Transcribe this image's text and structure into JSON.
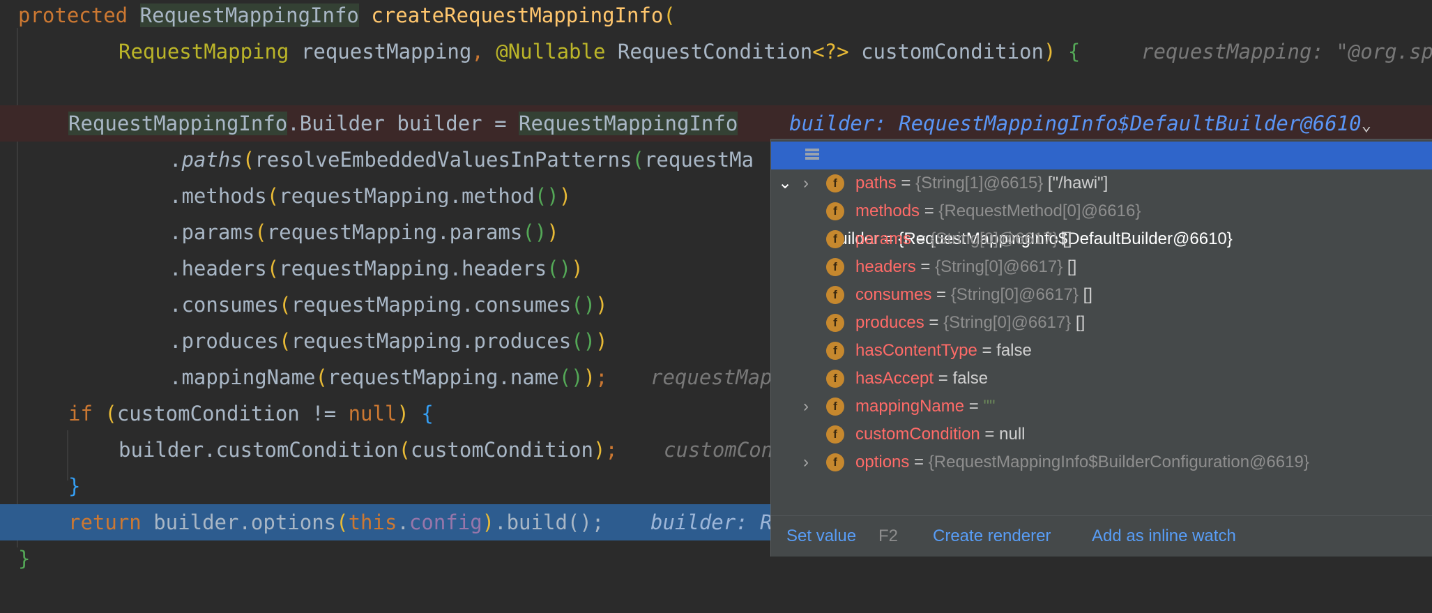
{
  "code": {
    "line1": {
      "kw": "protected",
      "type": "RequestMappingInfo",
      "method": "createRequestMappingInfo",
      "paren": "("
    },
    "line2": {
      "param_type": "RequestMapping",
      "param_name": " requestMapping",
      "comma": ", ",
      "annotation": "@Nullable",
      "type2": " RequestCondition",
      "generic": "<?>",
      "param2": " customCondition",
      "close": ") ",
      "brace": "{",
      "hint": "requestMapping: \"@org.sp"
    },
    "line4": {
      "type": "RequestMappingInfo",
      "rest": ".Builder builder = ",
      "type2": "RequestMappingInfo",
      "hint": "builder: RequestMappingInfo$DefaultBuilder@6610",
      "hint_chevron": "⌄"
    },
    "line5": {
      "dot": ".",
      "method": "paths",
      "open": "(",
      "arg": "resolveEmbeddedValuesInPatterns",
      "open2": "(",
      "arg2": "requestMa"
    },
    "line6": {
      "prefix": ".methods",
      "open": "(",
      "arg": "requestMapping.method",
      "call": "()",
      "close": ")"
    },
    "line7": {
      "prefix": ".params",
      "open": "(",
      "arg": "requestMapping.params",
      "call": "()",
      "close": ")"
    },
    "line8": {
      "prefix": ".headers",
      "open": "(",
      "arg": "requestMapping.headers",
      "call": "()",
      "close": ")"
    },
    "line9": {
      "prefix": ".consumes",
      "open": "(",
      "arg": "requestMapping.consumes",
      "call": "()",
      "close": ")"
    },
    "line10": {
      "prefix": ".produces",
      "open": "(",
      "arg": "requestMapping.produces",
      "call": "()",
      "close": ")"
    },
    "line11": {
      "prefix": ".mappingName",
      "open": "(",
      "arg": "requestMapping.name",
      "call": "()",
      "close": ")",
      "semi": ";",
      "hint": "requestMap"
    },
    "line12": {
      "kw": "if",
      "open": " (",
      "cond": "customCondition != ",
      "null": "null",
      "close": ") ",
      "brace": "{"
    },
    "line13": {
      "prefix": "builder.customCondition",
      "open": "(",
      "arg": "customCondition",
      "close": ")",
      "semi": ";",
      "hint": "customCon"
    },
    "line14": {
      "brace": "}"
    },
    "line15": {
      "kw": "return",
      "prefix": " builder.options",
      "open": "(",
      "this": "this",
      "dot": ".",
      "field": "config",
      "close": ")",
      "rest": ".build();",
      "hint": "builder: R"
    },
    "line16": {
      "brace": "}"
    }
  },
  "popup": {
    "root": {
      "name": "builder",
      "eq": " = ",
      "value": "{RequestMappingInfo$DefaultBuilder@6610}"
    },
    "fields": [
      {
        "name": "paths",
        "eq": " = ",
        "ref": "{String[1]@6615}",
        "extra": " [\"/hawi\"]",
        "expandable": true
      },
      {
        "name": "methods",
        "eq": " = ",
        "ref": "{RequestMethod[0]@6616}",
        "extra": "",
        "expandable": false
      },
      {
        "name": "params",
        "eq": " = ",
        "ref": "{String[0]@6617}",
        "extra": " []",
        "expandable": false
      },
      {
        "name": "headers",
        "eq": " = ",
        "ref": "{String[0]@6617}",
        "extra": " []",
        "expandable": false
      },
      {
        "name": "consumes",
        "eq": " = ",
        "ref": "{String[0]@6617}",
        "extra": " []",
        "expandable": false
      },
      {
        "name": "produces",
        "eq": " = ",
        "ref": "{String[0]@6617}",
        "extra": " []",
        "expandable": false
      },
      {
        "name": "hasContentType",
        "eq": " = ",
        "ref": "",
        "extra": "false",
        "expandable": false
      },
      {
        "name": "hasAccept",
        "eq": " = ",
        "ref": "",
        "extra": "false",
        "expandable": false
      },
      {
        "name": "mappingName",
        "eq": " = ",
        "ref": "",
        "extra": "\"\"",
        "expandable": true
      },
      {
        "name": "customCondition",
        "eq": " = ",
        "ref": "",
        "extra": "null",
        "expandable": false
      },
      {
        "name": "options",
        "eq": " = ",
        "ref": "{RequestMappingInfo$BuilderConfiguration@6619}",
        "extra": "",
        "expandable": true
      }
    ],
    "field_icon_letter": "f",
    "footer": {
      "set_value": "Set value",
      "set_value_key": "F2",
      "create_renderer": "Create renderer",
      "add_inline_watch": "Add as inline watch"
    }
  },
  "colors": {
    "editor_bg": "#2b2b2b",
    "execution_line": "#2d5c8f",
    "popup_bg": "#45494a",
    "selected_row": "#2f65ca",
    "field_name": "#ff6b68",
    "link": "#589df6"
  }
}
